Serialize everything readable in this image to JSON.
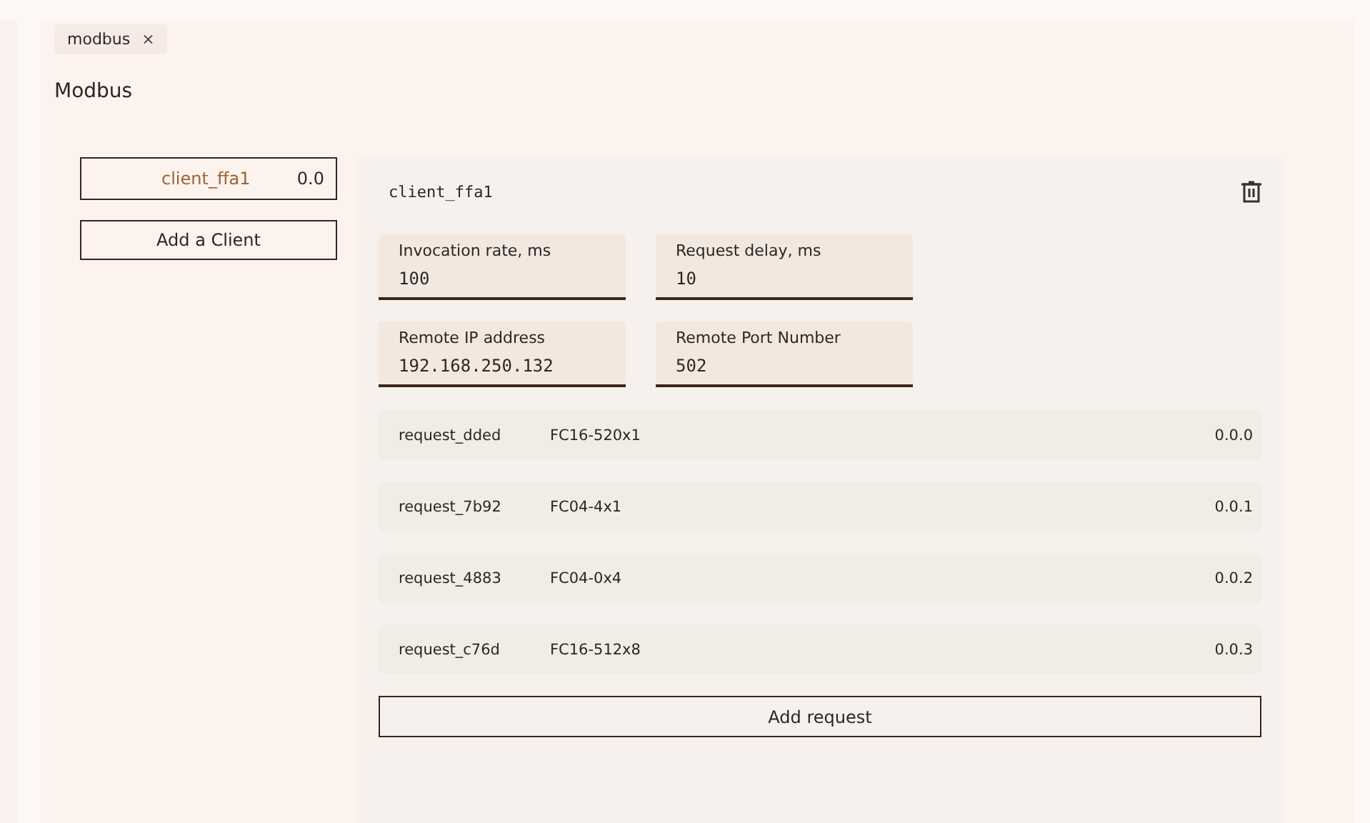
{
  "tabs": [
    {
      "label": "modbus",
      "close": "×"
    }
  ],
  "title": "Modbus",
  "clients": [
    {
      "name": "client_ffa1",
      "address": "0.0",
      "selected": true
    }
  ],
  "add_client": "Add a Client",
  "detail": {
    "name": "client_ffa1",
    "fields": [
      {
        "label": "Invocation rate, ms",
        "value": "100"
      },
      {
        "label": "Request delay, ms",
        "value": "10"
      },
      {
        "label": "Remote IP address",
        "value": "192.168.250.132"
      },
      {
        "label": "Remote Port Number",
        "value": "502"
      }
    ],
    "requests": [
      {
        "name": "request_dded",
        "function": "FC16-520x1",
        "address": "0.0.0"
      },
      {
        "name": "request_7b92",
        "function": "FC04-4x1",
        "address": "0.0.1"
      },
      {
        "name": "request_4883",
        "function": "FC04-0x4",
        "address": "0.0.2"
      },
      {
        "name": "request_c76d",
        "function": "FC16-512x8",
        "address": "0.0.3"
      }
    ],
    "add_request": "Add request"
  }
}
